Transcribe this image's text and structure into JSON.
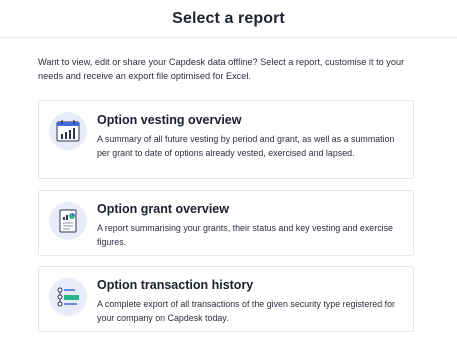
{
  "header": {
    "title": "Select a report"
  },
  "intro": {
    "text": "Want to view, edit or share your Capdesk data offline? Select a report, customise it to your needs and receive an export file optimised for Excel."
  },
  "reports": [
    {
      "title": "Option vesting overview",
      "description": "A summary of all future vesting by period and grant, as well as a summation per grant to date of options already vested, exercised and lapsed.",
      "icon": "calendar-bar-chart-icon"
    },
    {
      "title": "Option grant overview",
      "description": "A report summarising your grants, their status and key vesting and exercise figures.",
      "icon": "document-chart-icon"
    },
    {
      "title": "Option transaction history",
      "description": "A complete export of all transactions of the given security type registered for your company on Capdesk today.",
      "icon": "transaction-timeline-icon"
    }
  ],
  "colors": {
    "icon_circle": "#e9ecf8",
    "icon_accent": "#3f6ad8",
    "icon_green": "#2bb38a",
    "border": "#e2e5ec"
  }
}
